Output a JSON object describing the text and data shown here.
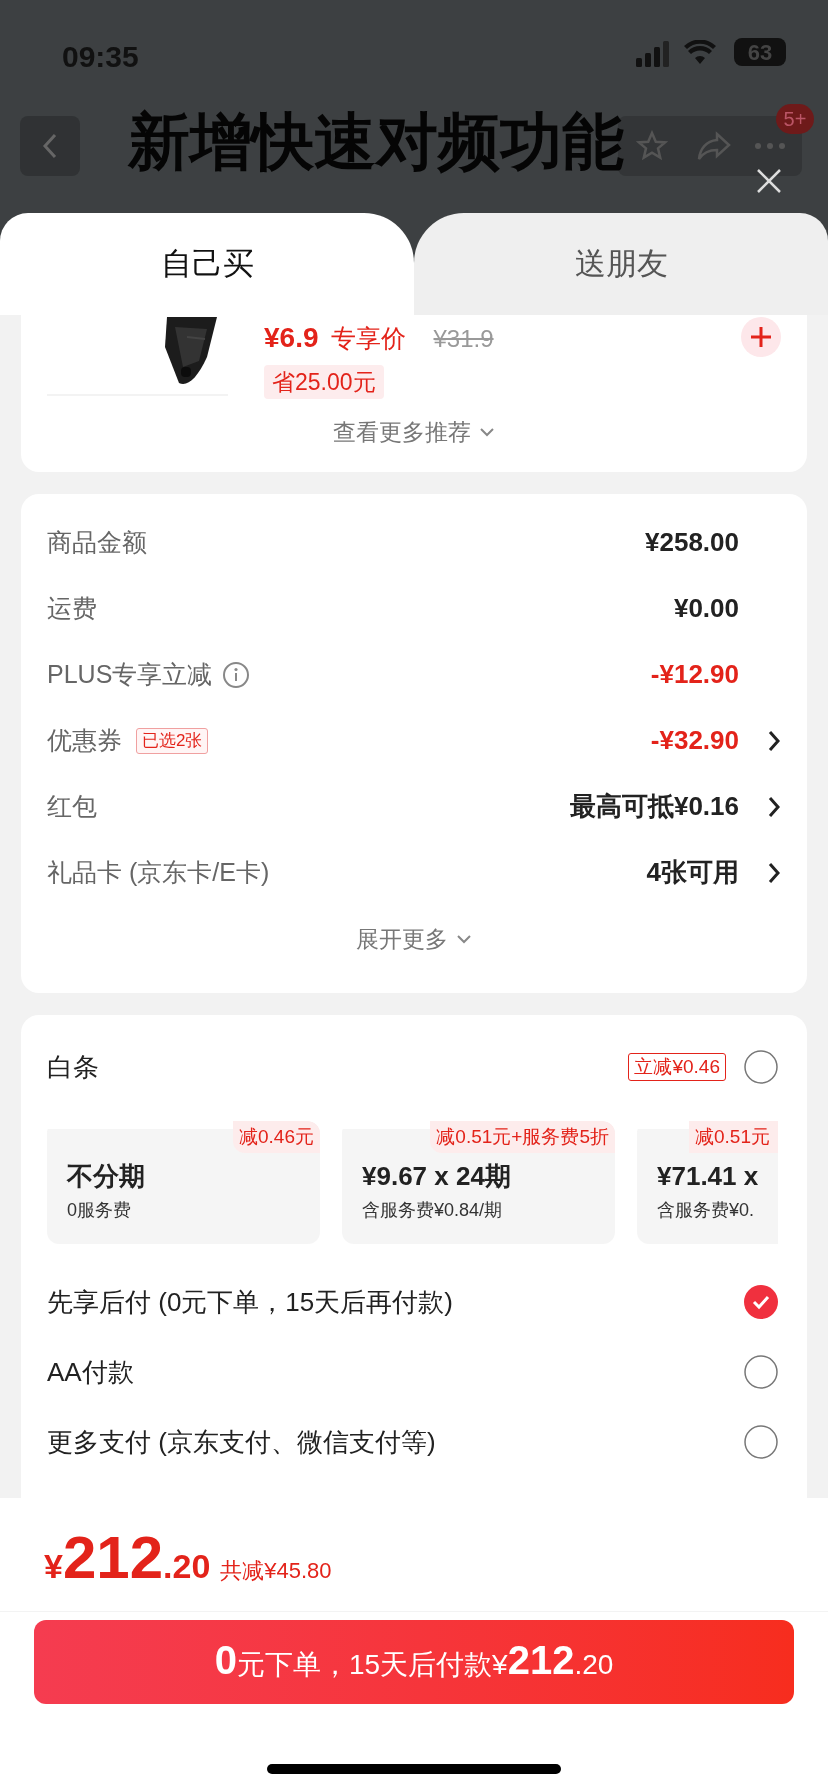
{
  "status_bar": {
    "time": "09:35",
    "battery": "63"
  },
  "nav": {
    "badge": "5+"
  },
  "overlay_caption": "新增快速对频功能",
  "tabs": [
    {
      "label": "自己买",
      "selected": true
    },
    {
      "label": "送朋友",
      "selected": false
    }
  ],
  "recommendation": {
    "price": "¥6.9",
    "price_tag": "专享价",
    "original_price": "¥31.9",
    "saving": "省25.00元",
    "more": "查看更多推荐"
  },
  "summary": {
    "rows": [
      {
        "label": "商品金额",
        "value": "¥258.00",
        "discount": false,
        "info": false,
        "arrow": false
      },
      {
        "label": "运费",
        "value": "¥0.00",
        "discount": false,
        "info": false,
        "arrow": false
      },
      {
        "label": "PLUS专享立减",
        "value": "-¥12.90",
        "discount": true,
        "info": true,
        "arrow": false
      },
      {
        "label": "优惠券",
        "badge": "已选2张",
        "value": "-¥32.90",
        "discount": true,
        "info": false,
        "arrow": true
      },
      {
        "label": "红包",
        "value": "最高可抵¥0.16",
        "discount": false,
        "info": false,
        "arrow": true
      },
      {
        "label": "礼品卡 (京东卡/E卡)",
        "value": "4张可用",
        "discount": false,
        "info": false,
        "arrow": true
      }
    ],
    "expand": "展开更多"
  },
  "payment": {
    "baitiao": {
      "label": "白条",
      "badge": "立减¥0.46",
      "selected": false,
      "plans": [
        {
          "tag": "减0.46元",
          "title": "不分期",
          "note": "0服务费"
        },
        {
          "tag": "减0.51元+服务费5折",
          "title": "¥9.67 x 24期",
          "note": "含服务费¥0.84/期"
        },
        {
          "tag": "减0.51元",
          "title": "¥71.41 x",
          "note": "含服务费¥0.",
          "clipped": true
        }
      ]
    },
    "options": [
      {
        "label": "先享后付 (0元下单，15天后再付款)",
        "selected": true
      },
      {
        "label": "AA付款",
        "selected": false
      },
      {
        "label": "更多支付 (京东支付、微信支付等)",
        "selected": false
      }
    ]
  },
  "footer": {
    "currency": "¥",
    "total_integer": "212",
    "total_decimal": ".20",
    "saved": "共减¥45.80",
    "button": [
      {
        "text": "0",
        "kind": "large"
      },
      {
        "text": "元下单，15天后付款¥",
        "kind": "small"
      },
      {
        "text": "212",
        "kind": "large"
      },
      {
        "text": ".20",
        "kind": "small"
      }
    ]
  }
}
